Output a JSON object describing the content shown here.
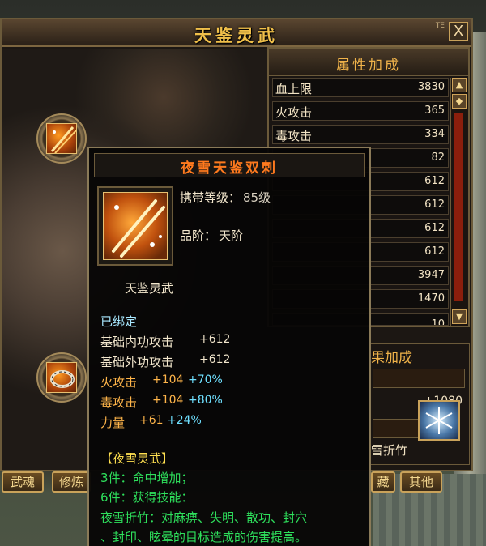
{
  "window": {
    "title": "天鉴灵武",
    "close_label": "X",
    "corner_mark": "TE"
  },
  "attributes": {
    "title": "属性加成",
    "rows": [
      {
        "name": "血上限",
        "value": "3830"
      },
      {
        "name": "火攻击",
        "value": "365"
      },
      {
        "name": "毒攻击",
        "value": "334"
      },
      {
        "name": "",
        "value": "82"
      },
      {
        "name": "",
        "value": "612"
      },
      {
        "name": "",
        "value": "612"
      },
      {
        "name": "",
        "value": "612"
      },
      {
        "name": "",
        "value": "612"
      },
      {
        "name": "",
        "value": "3947"
      },
      {
        "name": "",
        "value": "1470"
      },
      {
        "name": "",
        "value": "10"
      }
    ]
  },
  "set_effect": {
    "title": "果加成",
    "value": "+1080",
    "skill_name": "雪折竹"
  },
  "tabs": [
    "武魂",
    "修炼",
    "藏",
    "其他"
  ],
  "tooltip": {
    "title": "夜雪天鉴双刺",
    "level_label": "携带等级：",
    "level_value": "85级",
    "grade_label": "品阶：",
    "grade_value": "天阶",
    "category": "天鉴灵武",
    "bound": "已绑定",
    "stats": [
      {
        "name": "基础内功攻击",
        "base": "+612",
        "bonus": ""
      },
      {
        "name": "基础外功攻击",
        "base": "+612",
        "bonus": ""
      },
      {
        "name": "火攻击",
        "base": "+104",
        "bonus": "+70%"
      },
      {
        "name": "毒攻击",
        "base": "+104",
        "bonus": "+80%"
      },
      {
        "name": "力量",
        "base": "+61",
        "bonus": "+24%"
      }
    ],
    "set_name": "【夜雪灵武】",
    "set_lines": [
      "3件：命中增加；",
      "6件：获得技能：",
      "夜雪折竹：对麻痹、失明、散功、封穴",
      "、封印、眩晕的目标造成的伤害提高。"
    ]
  },
  "colors": {
    "title_gold": "#f1c04a",
    "item_name_orange": "#ff7a1e",
    "set_green": "#2ee05c",
    "set_name_yellow": "#ffe050",
    "bonus_cyan": "#6fe0ff"
  }
}
